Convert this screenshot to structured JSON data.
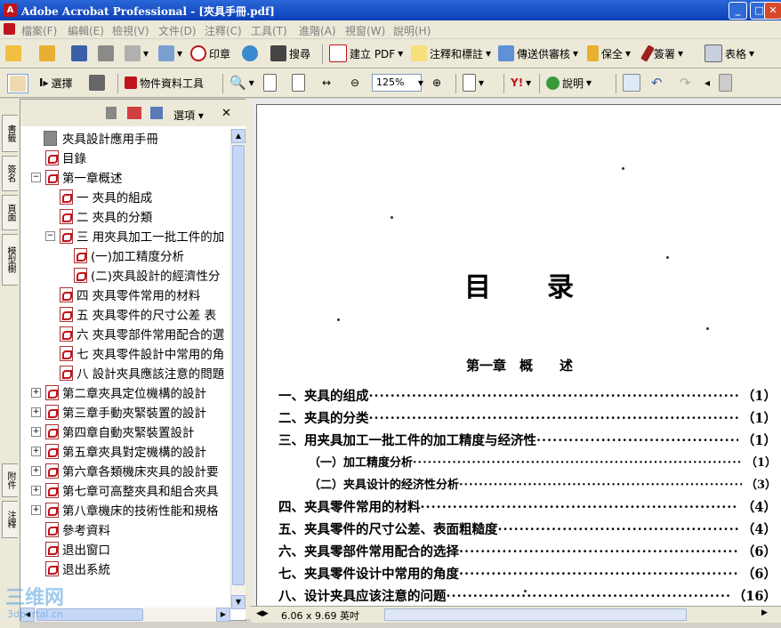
{
  "window": {
    "title": "Adobe Acrobat Professional - [夾具手冊.pdf]"
  },
  "menu": [
    "檔案(F)",
    "編輯(E)",
    "檢視(V)",
    "文件(D)",
    "注釋(C)",
    "工具(T)",
    "進階(A)",
    "視窗(W)",
    "說明(H)"
  ],
  "toolbar1": {
    "stamp": "印章",
    "search": "搜尋",
    "create_pdf": "建立 PDF",
    "comment": "注釋和標註",
    "review": "傳送供審核",
    "secure": "保全",
    "sign": "簽署",
    "forms": "表格"
  },
  "toolbar2": {
    "select": "選擇",
    "object_tool": "物件資料工具",
    "zoom": "125%",
    "help": "說明"
  },
  "side_tabs": [
    "書籤",
    "簽名",
    "頁面",
    "模型樹",
    "附件",
    "注釋"
  ],
  "nav": {
    "options": "選項",
    "close": "✕",
    "items": [
      {
        "label": "夾具設計應用手冊",
        "icon": "doc",
        "indent": 0,
        "toggle": ""
      },
      {
        "label": "目錄",
        "icon": "pdf",
        "indent": 1,
        "toggle": ""
      },
      {
        "label": "第一章概述",
        "icon": "pdf",
        "indent": 0,
        "toggle": "−"
      },
      {
        "label": "一 夾具的組成",
        "icon": "pdf",
        "indent": 2,
        "toggle": ""
      },
      {
        "label": "二 夾具的分類",
        "icon": "pdf",
        "indent": 2,
        "toggle": ""
      },
      {
        "label": "三 用夾具加工一批工件的加",
        "icon": "pdf",
        "indent": 1,
        "toggle": "−"
      },
      {
        "label": "(一)加工精度分析",
        "icon": "pdf",
        "indent": 3,
        "toggle": ""
      },
      {
        "label": "(二)夾具設計的經濟性分",
        "icon": "pdf",
        "indent": 3,
        "toggle": ""
      },
      {
        "label": "四 夾具零件常用的材料",
        "icon": "pdf",
        "indent": 2,
        "toggle": ""
      },
      {
        "label": "五 夾具零件的尺寸公差 表",
        "icon": "pdf",
        "indent": 2,
        "toggle": ""
      },
      {
        "label": "六 夾具零部件常用配合的選",
        "icon": "pdf",
        "indent": 2,
        "toggle": ""
      },
      {
        "label": "七 夾具零件設計中常用的角",
        "icon": "pdf",
        "indent": 2,
        "toggle": ""
      },
      {
        "label": "八 設計夾具應該注意的問題",
        "icon": "pdf",
        "indent": 2,
        "toggle": ""
      },
      {
        "label": "第二章夾具定位機構的設計",
        "icon": "pdf",
        "indent": 0,
        "toggle": "+"
      },
      {
        "label": "第三章手動夾緊裝置的設計",
        "icon": "pdf",
        "indent": 0,
        "toggle": "+"
      },
      {
        "label": "第四章自動夾緊裝置設計",
        "icon": "pdf",
        "indent": 0,
        "toggle": "+"
      },
      {
        "label": "第五章夾具對定機構的設計",
        "icon": "pdf",
        "indent": 0,
        "toggle": "+"
      },
      {
        "label": "第六章各類機床夾具的設計要",
        "icon": "pdf",
        "indent": 0,
        "toggle": "+"
      },
      {
        "label": "第七章可高整夾具和組合夾具",
        "icon": "pdf",
        "indent": 0,
        "toggle": "+"
      },
      {
        "label": "第八章機床的技術性能和規格",
        "icon": "pdf",
        "indent": 0,
        "toggle": "+"
      },
      {
        "label": "參考資料",
        "icon": "pdf",
        "indent": 1,
        "toggle": ""
      },
      {
        "label": "退出窗口",
        "icon": "pdf",
        "indent": 1,
        "toggle": ""
      },
      {
        "label": "退出系統",
        "icon": "pdf",
        "indent": 1,
        "toggle": ""
      }
    ]
  },
  "document": {
    "title": "目　　录",
    "chapter": "第一章　概　　述",
    "toc": [
      {
        "text": "一、夹具的组成",
        "page": "（1）",
        "sub": false
      },
      {
        "text": "二、夹具的分类",
        "page": "（1）",
        "sub": false
      },
      {
        "text": "三、用夹具加工一批工件的加工精度与经济性",
        "page": "（1）",
        "sub": false
      },
      {
        "text": "（一）加工精度分析",
        "page": "（1）",
        "sub": true
      },
      {
        "text": "（二）夹具设计的经济性分析",
        "page": "（3）",
        "sub": true
      },
      {
        "text": "四、夹具零件常用的材料",
        "page": "（4）",
        "sub": false
      },
      {
        "text": "五、夹具零件的尺寸公差、表面粗糙度",
        "page": "（4）",
        "sub": false
      },
      {
        "text": "六、夹具零部件常用配合的选择",
        "page": "（6）",
        "sub": false
      },
      {
        "text": "七、夹具零件设计中常用的角度",
        "page": "（6）",
        "sub": false
      },
      {
        "text": "八、设计夹具应该注意的问题",
        "page": "（16）",
        "sub": false
      }
    ]
  },
  "status": {
    "page_size": "6.06 x 9.69 英吋"
  },
  "watermark": {
    "main": "三维网",
    "sub": "3dportal.cn"
  }
}
